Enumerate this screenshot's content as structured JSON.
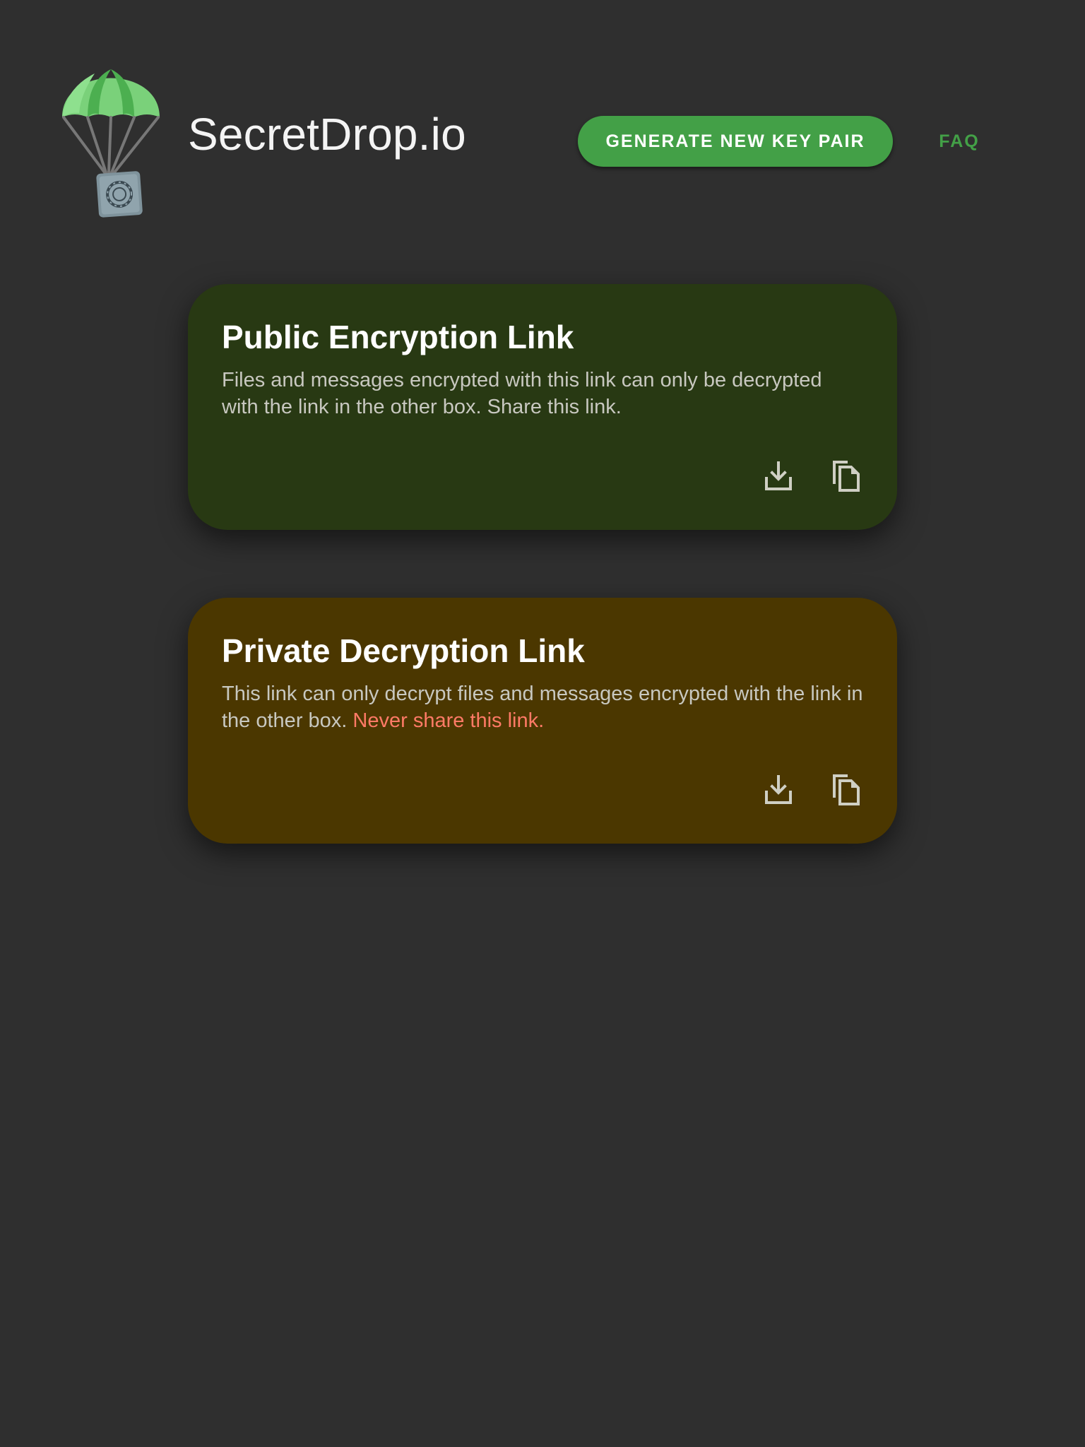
{
  "header": {
    "logo_icon": "parachute-safe-icon",
    "brand": "SecretDrop.io",
    "generate_button": "GENERATE NEW KEY PAIR",
    "faq_link": "FAQ"
  },
  "colors": {
    "background": "#2f2f2f",
    "accent": "#43a047",
    "public_card": "#283913",
    "private_card": "#4b3700",
    "warning_text": "#ff7a66"
  },
  "public_card": {
    "title": "Public Encryption Link",
    "description": "Files and messages encrypted with this link can only be decrypted with the link in the other box. Share this link.",
    "actions": [
      {
        "icon": "download-icon"
      },
      {
        "icon": "copy-icon"
      }
    ]
  },
  "private_card": {
    "title": "Private Decryption Link",
    "description": "This link can only decrypt files and messages encrypted with the link in the other box. ",
    "warning": "Never share this link.",
    "actions": [
      {
        "icon": "download-icon"
      },
      {
        "icon": "copy-icon"
      }
    ]
  }
}
